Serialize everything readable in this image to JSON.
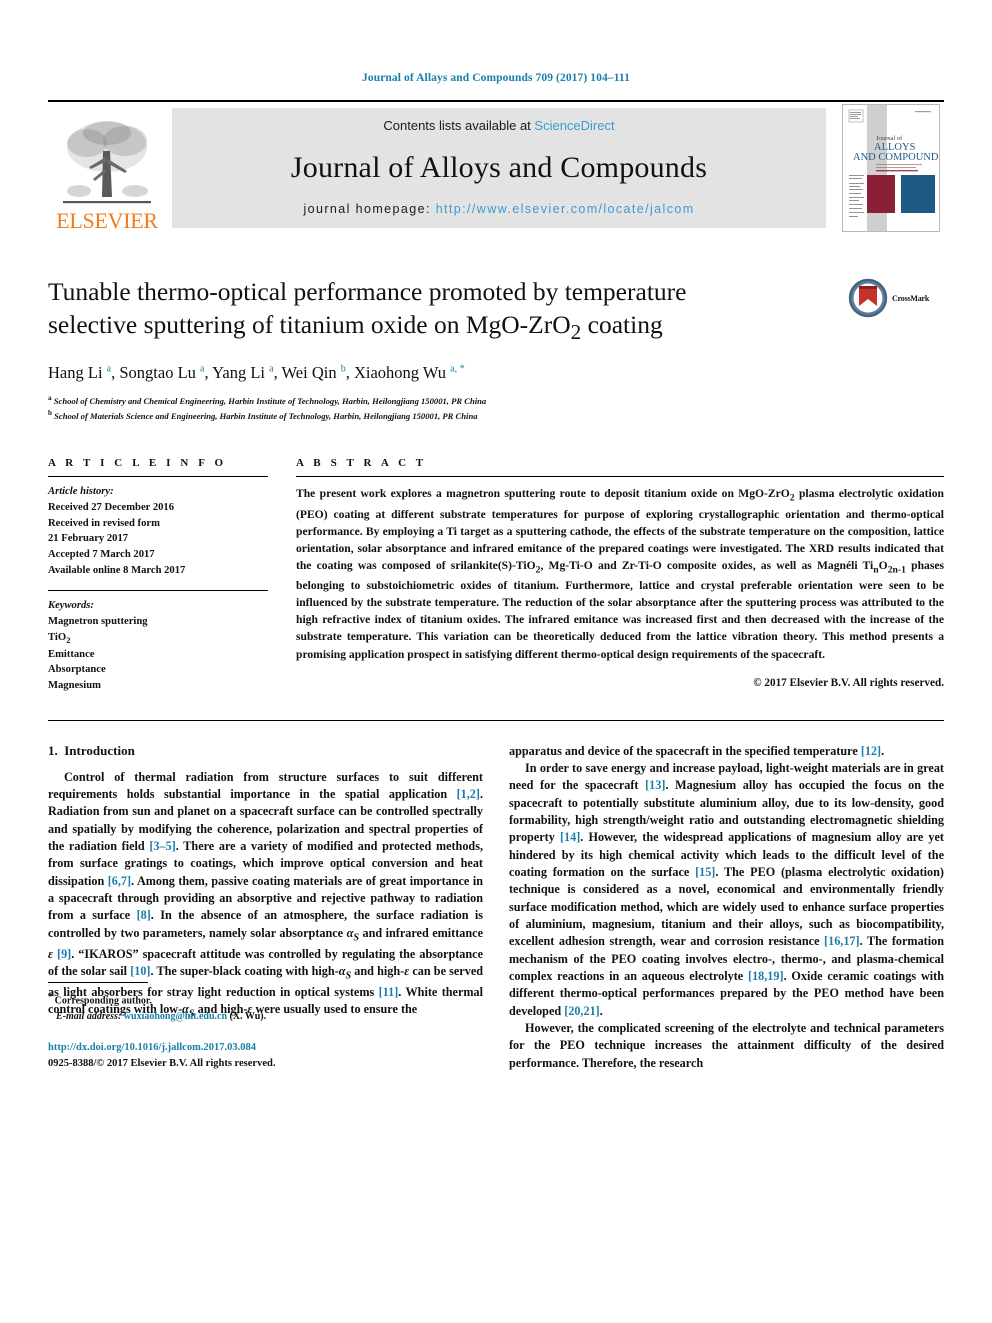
{
  "running_head": "Journal of Allays and Compounds 709 (2017) 104–111",
  "masthead": {
    "publisher_name": "ELSEVIER",
    "contents_prefix": "Contents lists available at ",
    "sciencedirect": "ScienceDirect",
    "journal_title": "Journal of Alloys and Compounds",
    "homepage_label": "journal homepage: ",
    "homepage_url": "http://www.elsevier.com/locate/jalcom",
    "cover": {
      "line1": "Journal of",
      "line2": "ALLOYS",
      "line3": "AND COMPOUNDS"
    },
    "link_color": "#3d9bd4",
    "band_color": "#e3e3e3",
    "elsevier_orange": "#f07c1a"
  },
  "article": {
    "title_line1": "Tunable thermo-optical performance promoted by temperature",
    "title_line2": "selective sputtering of titanium oxide on MgO-ZrO2 coating",
    "authors": "Hang Li a, Songtao Lu a, Yang Li a, Wei Qin b, Xiaohong Wu a, *",
    "affiliation_a": "School of Chemistry and Chemical Engineering, Harbin Institute of Technology, Harbin, Heilongjiang 150001, PR China",
    "affiliation_b": "School of Materials Science and Engineering, Harbin Institute of Technology, Harbin, Heilongjiang 150001, PR China",
    "crossmark_label": "CrossMark"
  },
  "article_info": {
    "heading": "A R T I C L E   I N F O",
    "history_label": "Article history:",
    "history": [
      "Received 27 December 2016",
      "Received in revised form",
      "21 February 2017",
      "Accepted 7 March 2017",
      "Available online 8 March 2017"
    ],
    "keywords_label": "Keywords:",
    "keywords": [
      "Magnetron sputtering",
      "TiO2",
      "Emittance",
      "Absorptance",
      "Magnesium"
    ]
  },
  "abstract": {
    "heading": "A B S T R A C T",
    "text": "The present work explores a magnetron sputtering route to deposit titanium oxide on MgO-ZrO2 plasma electrolytic oxidation (PEO) coating at different substrate temperatures for purpose of exploring crystallographic orientation and thermo-optical performance. By employing a Ti target as a sputtering cathode, the effects of the substrate temperature on the composition, lattice orientation, solar absorptance and infrared emitance of the prepared coatings were investigated. The XRD results indicated that the coating was composed of srilankite(S)-TiO2, Mg-Ti-O and Zr-Ti-O composite oxides, as well as Magnéli TinO2n-1 phases belonging to substoichiometric oxides of titanium. Furthermore, lattice and crystal preferable orientation were seen to be influenced by the substrate temperature. The reduction of the solar absorptance after the sputtering process was attributed to the high refractive index of titanium oxides. The infrared emitance was increased first and then decreased with the increase of the substrate temperature. This variation can be theoretically deduced from the lattice vibration theory. This method presents a promising application prospect in satisfying different thermo-optical design requirements of the spacecraft.",
    "copyright": "© 2017 Elsevier B.V. All rights reserved."
  },
  "introduction": {
    "section_number": "1.",
    "section_title": "Introduction",
    "left_para1_parts": [
      "Control of thermal radiation from structure surfaces to suit different requirements holds substantial importance in the spatial application ",
      "[1,2]",
      ". Radiation from sun and planet on a spacecraft surface can be controlled spectrally and spatially by modifying the coherence, polarization and spectral properties of the radiation field ",
      "[3–5]",
      ". There are a variety of modified and protected methods, from surface gratings to coatings, which improve optical conversion and heat dissipation ",
      "[6,7]",
      ". Among them, passive coating materials are of great importance in a spacecraft through providing an absorptive and rejective pathway to radiation from a surface ",
      "[8]",
      ". In the absence of an atmosphere, the surface radiation is controlled by two parameters, namely solar absorptance αS and infrared emittance ε ",
      "[9]",
      ". \"IKAROS\" spacecraft attitude was controlled by regulating the absorptance of the solar sail ",
      "[10]",
      ". The super-black coating with high-αS and high-ε can be served as light absorbers for stray light reduction in optical systems ",
      "[11]",
      ". White thermal control coatings with low-αS and high-ε were usually used to ensure the"
    ],
    "right_para1_parts": [
      "apparatus and device of the spacecraft in the specified temperature ",
      "[12]",
      "."
    ],
    "right_para2_parts": [
      "In order to save energy and increase payload, light-weight materials are in great need for the spacecraft ",
      "[13]",
      ". Magnesium alloy has occupied the focus on the spacecraft to potentially substitute aluminium alloy, due to its low-density, good formability, high strength/weight ratio and outstanding electromagnetic shielding property ",
      "[14]",
      ". However, the widespread applications of magnesium alloy are yet hindered by its high chemical activity which leads to the difficult level of the coating formation on the surface ",
      "[15]",
      ". The PEO (plasma electrolytic oxidation) technique is considered as a novel, economical and environmentally friendly surface modification method, which are widely used to enhance surface properties of aluminium, magnesium, titanium and their alloys, such as biocompatibility, excellent adhesion strength, wear and corrosion resistance ",
      "[16,17]",
      ". The formation mechanism of the PEO coating involves electro-, thermo-, and plasma-chemical complex reactions in an aqueous electrolyte ",
      "[18,19]",
      ". Oxide ceramic coatings with different thermo-optical performances prepared by the PEO method have been developed ",
      "[20,21]",
      "."
    ],
    "right_para3_parts": [
      "However, the complicated screening of the electrolyte and technical parameters for the PEO technique increases the attainment difficulty of the desired performance. Therefore, the research"
    ]
  },
  "footer": {
    "corresponding_marker": "*",
    "corresponding_label": "Corresponding author.",
    "email_label": "E-mail address:",
    "email": "wuxiaohong@hit.edu.cn",
    "email_suffix": "(X. Wu).",
    "doi_url": "http://dx.doi.org/10.1016/j.jallcom.2017.03.084",
    "issn_line": "0925-8388/© 2017 Elsevier B.V. All rights reserved."
  },
  "colors": {
    "link": "#1a7fa8",
    "ref": "#1a7fa8",
    "sciencedirect": "#3d9bd4",
    "elsevier": "#f07c1a"
  }
}
